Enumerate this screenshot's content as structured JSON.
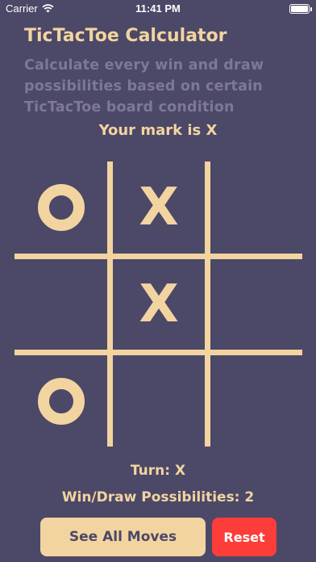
{
  "status_bar": {
    "carrier": "Carrier",
    "time": "11:41 PM",
    "wifi_icon": "wifi-icon",
    "battery_icon": "battery-icon",
    "battery_level": 1.0
  },
  "header": {
    "title": "TicTacToe Calculator",
    "subtitle": "Calculate every win and draw possibilities based on certain TicTacToe board condition"
  },
  "your_mark_label": "Your mark is X",
  "board": {
    "cells": [
      "O",
      "X",
      "",
      "",
      "X",
      "",
      "O",
      "",
      ""
    ]
  },
  "turn_label": "Turn: X",
  "possibilities_label": "Win/Draw Possibilities: 2",
  "buttons": {
    "see_all_moves": "See All Moves",
    "reset": "Reset"
  },
  "colors": {
    "background": "#4c4867",
    "accent": "#f2d4a0",
    "subtitle": "#7d7897",
    "reset": "#fc3d39"
  }
}
